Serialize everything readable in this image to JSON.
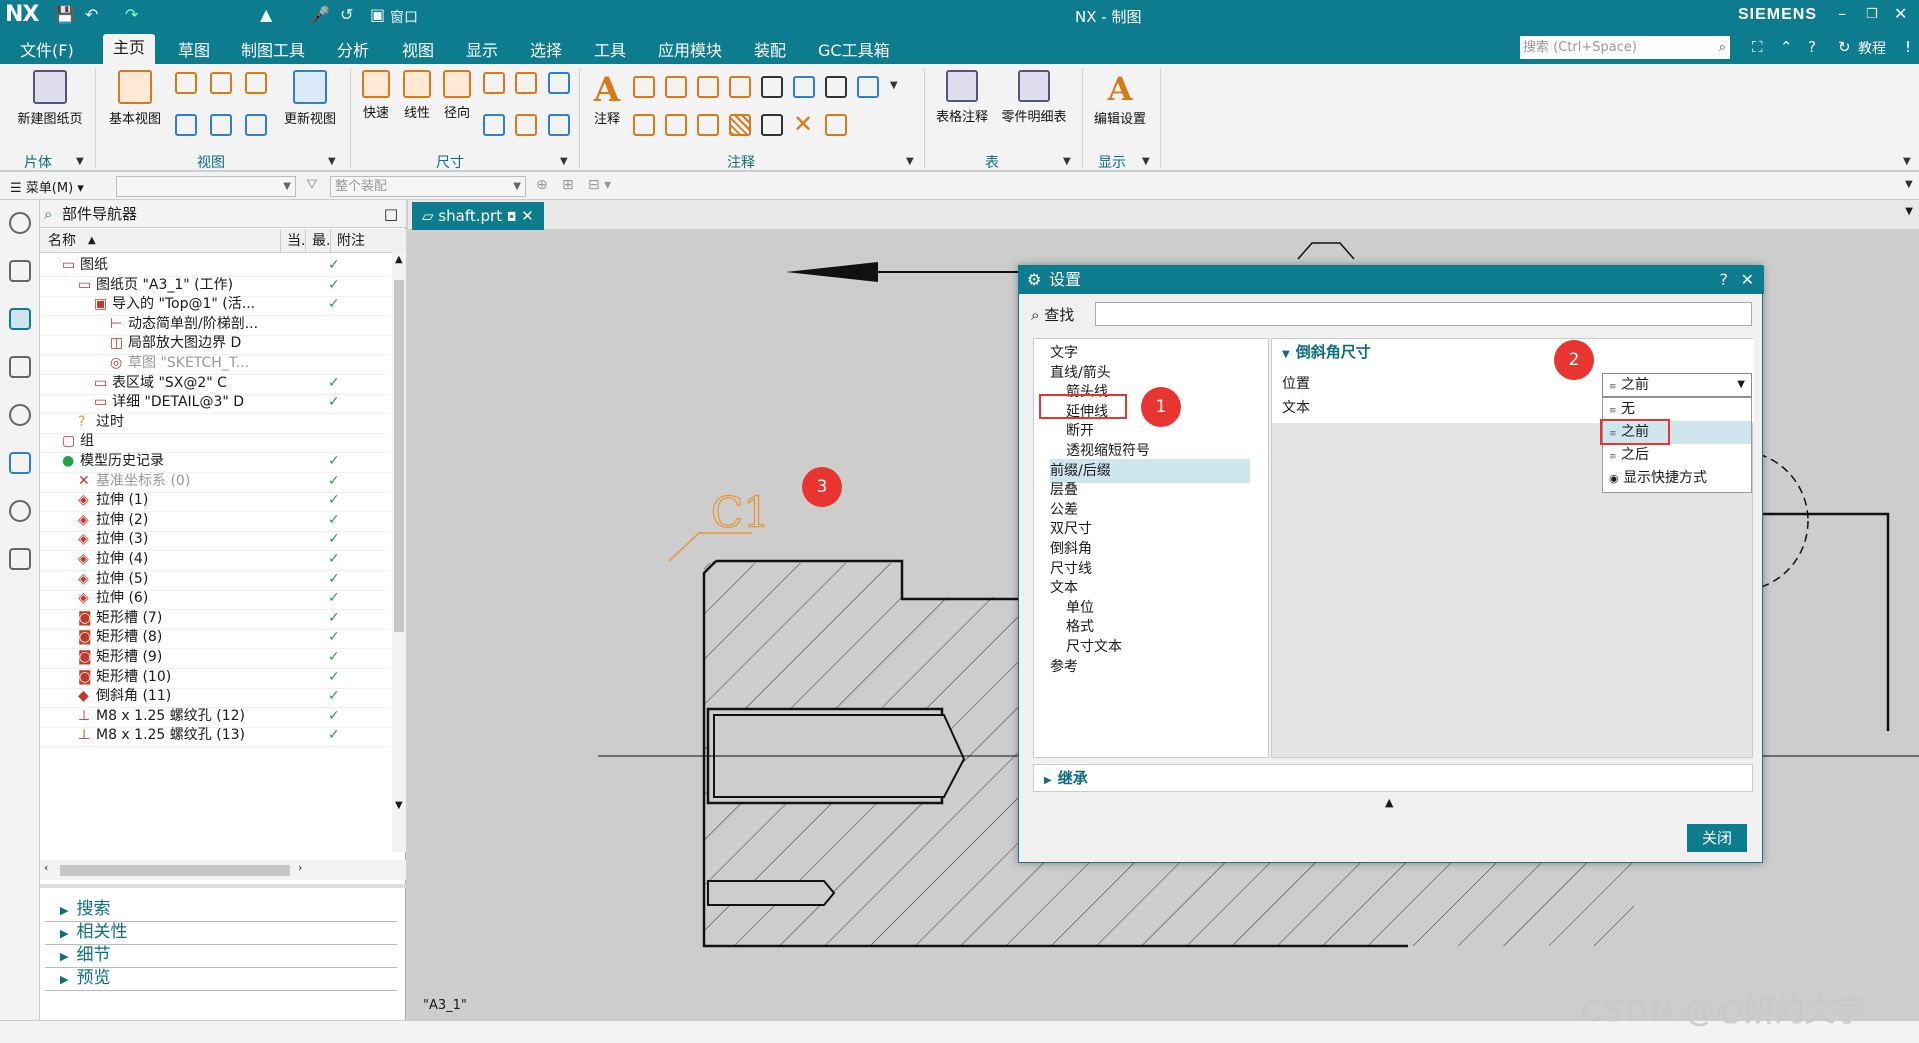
{
  "app": {
    "logo": "NX",
    "title": "NX - 制图",
    "brand": "SIEMENS",
    "window_menu": "窗口"
  },
  "menus": [
    "文件(F)",
    "主页",
    "草图",
    "制图工具",
    "分析",
    "视图",
    "显示",
    "选择",
    "工具",
    "应用模块",
    "装配",
    "GC工具箱"
  ],
  "search": {
    "placeholder": "搜索 (Ctrl+Space)",
    "tutorial": "教程"
  },
  "ribbon": {
    "buttons": {
      "new_sheet": "新建图纸页",
      "base_view": "基本视图",
      "update_view": "更新视图",
      "rapid": "快速",
      "linear": "线性",
      "radial": "径向",
      "note": "注释",
      "table_note": "表格注释",
      "parts_list": "零件明细表",
      "edit_settings": "编辑设置"
    },
    "groups": {
      "sheet": "片体",
      "view": "视图",
      "dimension": "尺寸",
      "annotation": "注释",
      "table": "表",
      "display": "显示"
    }
  },
  "cmdbar": {
    "menu": "菜单(M)",
    "assembly": "整个装配"
  },
  "navigator": {
    "title": "部件导航器",
    "columns": [
      "名称",
      "当.",
      "最.",
      "附注"
    ],
    "rows": [
      "图纸",
      "图纸页 \"A3_1\" (工作)",
      "导入的 \"Top@1\" (活...",
      "动态简单剖/阶梯剖...",
      "局部放大图边界 D",
      "草图 \"SKETCH_T...",
      "表区域 \"SX@2\" C",
      "详细 \"DETAIL@3\" D",
      "过时",
      "组",
      "模型历史记录",
      "基准坐标系 (0)",
      "拉伸 (1)",
      "拉伸 (2)",
      "拉伸 (3)",
      "拉伸 (4)",
      "拉伸 (5)",
      "拉伸 (6)",
      "矩形槽 (7)",
      "矩形槽 (8)",
      "矩形槽 (9)",
      "矩形槽 (10)",
      "倒斜角 (11)",
      "M8 x 1.25 螺纹孔 (12)",
      "M8 x 1.25 螺纹孔 (13)"
    ],
    "sections": [
      "搜索",
      "相关性",
      "细节",
      "预览"
    ]
  },
  "tab": {
    "label": "shaft.prt"
  },
  "sheet_label": "\"A3_1\"",
  "annotation_text": "C1",
  "dialog": {
    "title": "设置",
    "find_label": "查找",
    "tree": [
      "文字",
      "直线/箭头",
      "箭头线",
      "延伸线",
      "断开",
      "透视缩短符号",
      "前缀/后缀",
      "层叠",
      "公差",
      "双尺寸",
      "倒斜角",
      "尺寸线",
      "文本",
      "单位",
      "格式",
      "尺寸文本",
      "参考"
    ],
    "section_title": "倒斜角尺寸",
    "position_label": "位置",
    "text_label": "文本",
    "selected": "之前",
    "options": [
      "无",
      "之前",
      "之后",
      "显示快捷方式"
    ],
    "inherit": "继承",
    "close": "关闭"
  },
  "badges": [
    "1",
    "2",
    "3"
  ],
  "watermark": "CSDN @心妍的文字",
  "colors": {
    "teal": "#0d7c8e",
    "badge_red": "#e8352f",
    "check_green": "#22a24a",
    "annotation_orange": "#e8952f"
  }
}
